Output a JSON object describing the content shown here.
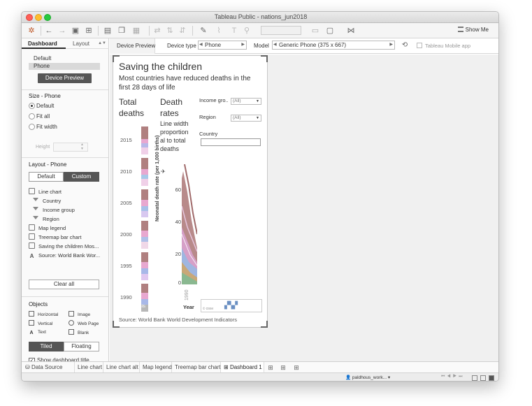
{
  "window": {
    "title": "Tableau Public - nations_jun2018"
  },
  "toolbar": {
    "show_me": "Show Me"
  },
  "left_panel": {
    "tabs": [
      "Dashboard",
      "Layout"
    ],
    "device_list": [
      "Default",
      "Phone"
    ],
    "device_preview_button": "Device Preview",
    "size_title": "Size - Phone",
    "size_options": [
      "Default",
      "Fit all",
      "Fit width"
    ],
    "height_label": "Height",
    "layout_title": "Layout - Phone",
    "layout_modes": [
      "Default",
      "Custom"
    ],
    "layout_items": [
      "Line chart",
      "Country",
      "Income group",
      "Region",
      "Map legend",
      "Treemap bar chart",
      "Saving the children Mos...",
      "Source: World Bank Wor..."
    ],
    "clear_all": "Clear all",
    "objects_title": "Objects",
    "objects": [
      "Horizontal",
      "Image",
      "Vertical",
      "Web Page",
      "Text",
      "Blank"
    ],
    "tiled": "Tiled",
    "floating": "Floating",
    "show_title": "Show dashboard title"
  },
  "device_bar": {
    "preview": "Device Preview",
    "device_type_label": "Device type",
    "device_type_value": "Phone",
    "model_label": "Model",
    "model_value": "Generic Phone (375 x 667)",
    "mobile_app": "Tableau Mobile app"
  },
  "dashboard": {
    "title": "Saving the children",
    "subtitle": "Most countries have reduced deaths in the first 28 days of life",
    "total_deaths": "Total deaths",
    "death_rates": "Death rates",
    "line_width_note": "Line width proportion al to total deaths",
    "filters": [
      {
        "label": "Income gro..",
        "value": "(All)"
      },
      {
        "label": "Region",
        "value": "(All)"
      }
    ],
    "country_label": "Country",
    "years": [
      "2015",
      "2010",
      "2005",
      "2000",
      "1995",
      "1990"
    ],
    "y_axis_title": "Neonatal death rate (per 1,000 births)",
    "y_ticks": [
      "60",
      "40",
      "20",
      "0"
    ],
    "x_tick": "1990",
    "x_title": "Year",
    "map_copyright": "© OSM",
    "treemap_label": "ails",
    "source": "Source: World Bank World Development Indicators"
  },
  "sheet_tabs": [
    "Data Source",
    "Line chart",
    "Line chart alt",
    "Map legend",
    "Treemap bar chart",
    "Dashboard 1"
  ],
  "status": {
    "user": "paldhous_work..."
  }
}
